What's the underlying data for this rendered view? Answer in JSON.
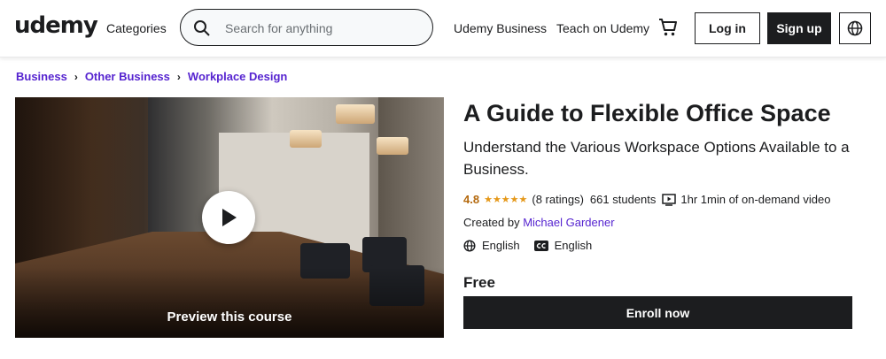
{
  "header": {
    "logo": "udemy",
    "categories_label": "Categories",
    "search_placeholder": "Search for anything",
    "search_value": "",
    "business_link": "Udemy Business",
    "teach_link": "Teach on Udemy",
    "login_label": "Log in",
    "signup_label": "Sign up",
    "icons": [
      "search-icon",
      "cart-icon",
      "globe-icon"
    ]
  },
  "breadcrumb": {
    "items": [
      "Business",
      "Other Business",
      "Workplace Design"
    ],
    "separator": "›"
  },
  "preview": {
    "label": "Preview this course",
    "icon": "play-icon"
  },
  "course": {
    "title": "A Guide to Flexible Office Space",
    "subtitle": "Understand the Various Workspace Options Available to a Business.",
    "rating": "4.8",
    "stars": "★★★★★",
    "rating_count": "(8 ratings)",
    "students": "661 students",
    "video_length": "1hr 1min of on-demand video",
    "created_prefix": "Created by",
    "author": "Michael Gardener",
    "language": "English",
    "captions": "English",
    "price": "Free",
    "enroll_label": "Enroll now"
  },
  "colors": {
    "text": "#1c1d1f",
    "link_purple": "#5624d0",
    "rating_orange": "#b4690e",
    "star_yellow": "#e59819",
    "button_dark": "#1c1d1f"
  }
}
